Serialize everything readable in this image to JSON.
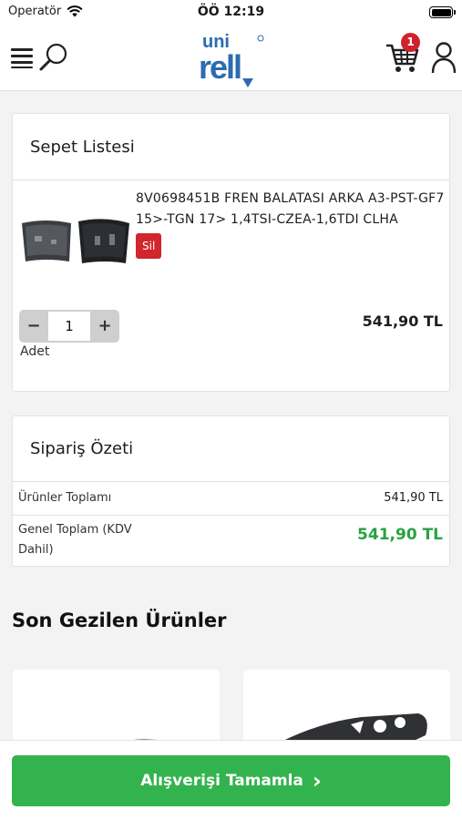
{
  "status_bar": {
    "carrier": "Operatör",
    "time": "ÖÖ 12:19"
  },
  "header": {
    "logo_top": "uni",
    "logo_bottom": "rell",
    "cart_count": "1",
    "brand_color": "#2b6cb0"
  },
  "cart": {
    "title": "Sepet Listesi",
    "item": {
      "name": "8V0698451B FREN BALATASI ARKA A3-PST-GF7 15>-TGN 17> 1,4TSI-CZEA-1,6TDI CLHA",
      "delete_label": "Sil",
      "quantity": "1",
      "minus_label": "−",
      "plus_label": "+",
      "quantity_label": "Adet",
      "price": "541,90 TL"
    }
  },
  "summary": {
    "title": "Sipariş Özeti",
    "products_total_label": "Ürünler Toplamı",
    "products_total_value": "541,90 TL",
    "grand_total_label": "Genel Toplam (KDV Dahil)",
    "grand_total_value": "541,90 TL"
  },
  "recent": {
    "title": "Son Gezilen Ürünler"
  },
  "checkout": {
    "label": "Alışverişi Tamamla",
    "arrow": "›"
  },
  "colors": {
    "accent_green": "#33b34d",
    "danger_red": "#d1262d",
    "badge_red": "#d0222c"
  }
}
